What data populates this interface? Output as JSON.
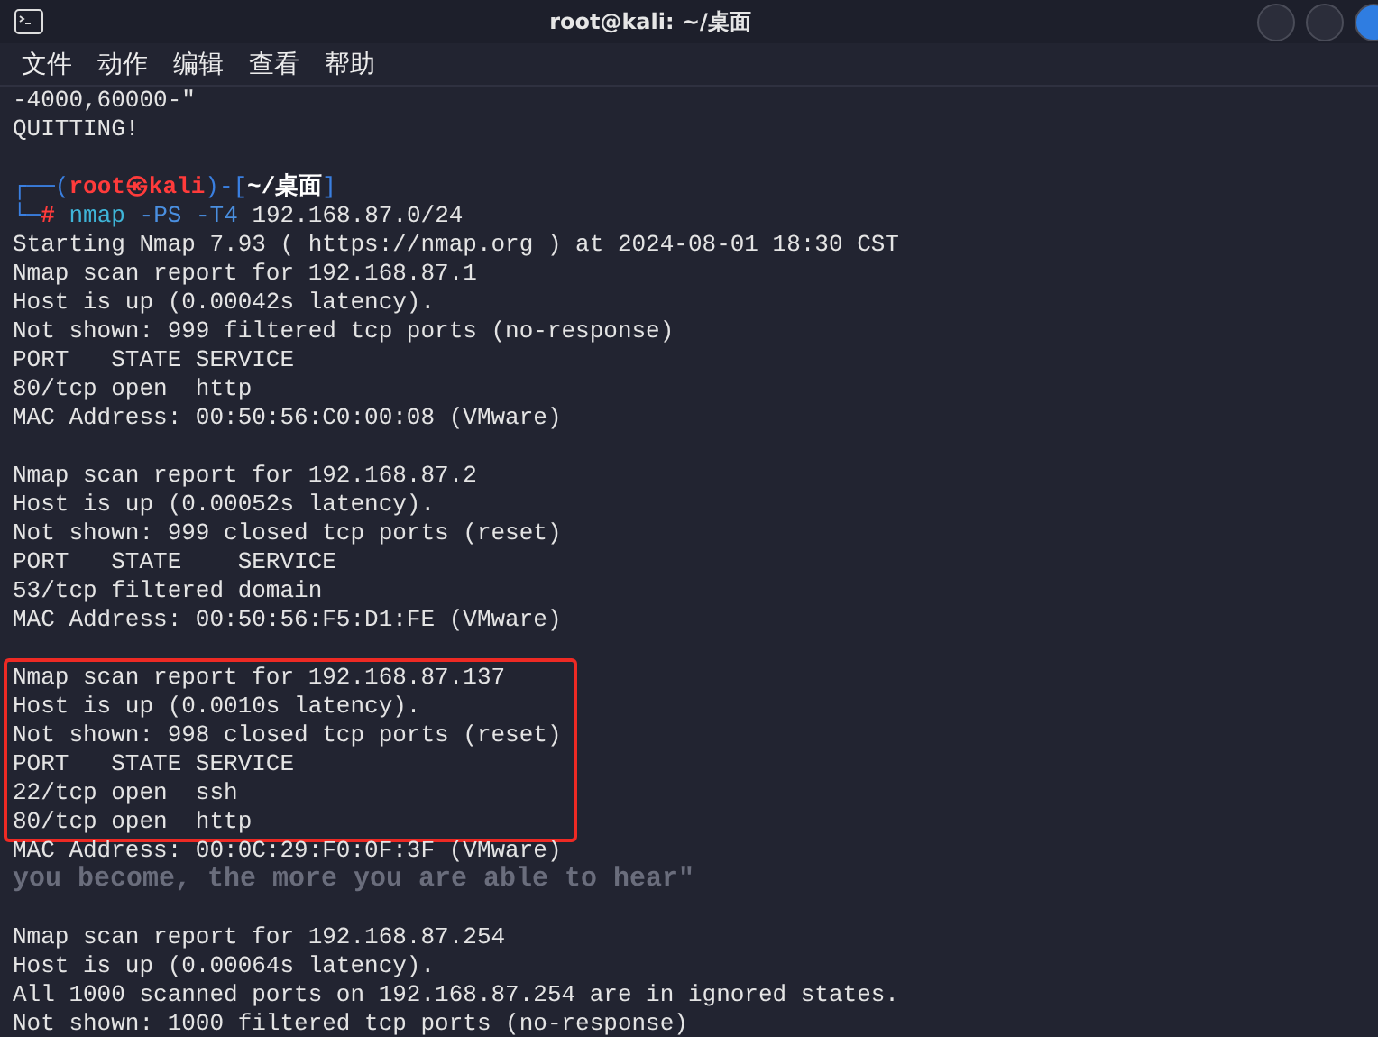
{
  "window": {
    "title": "root@kali: ~/桌面"
  },
  "menu": [
    "文件",
    "动作",
    "编辑",
    "查看",
    "帮助"
  ],
  "terminal": {
    "blocks": [
      {
        "highlighted": false,
        "lines": [
          {
            "kind": "text",
            "text": "-4000,60000-\""
          },
          {
            "kind": "text",
            "text": "QUITTING!"
          },
          {
            "kind": "blank"
          },
          {
            "kind": "prompt",
            "frame_open": "┌──(",
            "user": "root㉿kali",
            "frame_mid": ")-[",
            "path": "~/桌面",
            "frame_close": "]"
          },
          {
            "kind": "command",
            "frame": "└─",
            "sigil": "#",
            "program": "nmap",
            "options": "-PS -T4",
            "target": "192.168.87.0/24"
          },
          {
            "kind": "text",
            "text": "Starting Nmap 7.93 ( https://nmap.org ) at 2024-08-01 18:30 CST"
          },
          {
            "kind": "text",
            "text": "Nmap scan report for 192.168.87.1"
          },
          {
            "kind": "text",
            "text": "Host is up (0.00042s latency)."
          },
          {
            "kind": "text",
            "text": "Not shown: 999 filtered tcp ports (no-response)"
          },
          {
            "kind": "text",
            "text": "PORT   STATE SERVICE"
          },
          {
            "kind": "text",
            "text": "80/tcp open  http"
          },
          {
            "kind": "text",
            "text": "MAC Address: 00:50:56:C0:00:08 (VMware)"
          },
          {
            "kind": "blank"
          },
          {
            "kind": "text",
            "text": "Nmap scan report for 192.168.87.2"
          },
          {
            "kind": "text",
            "text": "Host is up (0.00052s latency)."
          },
          {
            "kind": "text",
            "text": "Not shown: 999 closed tcp ports (reset)"
          },
          {
            "kind": "text",
            "text": "PORT   STATE    SERVICE"
          },
          {
            "kind": "text",
            "text": "53/tcp filtered domain"
          },
          {
            "kind": "text",
            "text": "MAC Address: 00:50:56:F5:D1:FE (VMware)"
          },
          {
            "kind": "blank"
          }
        ]
      },
      {
        "highlighted": true,
        "lines": [
          {
            "kind": "text",
            "text": "Nmap scan report for 192.168.87.137"
          },
          {
            "kind": "text",
            "text": "Host is up (0.0010s latency)."
          },
          {
            "kind": "text",
            "text": "Not shown: 998 closed tcp ports (reset)"
          },
          {
            "kind": "text",
            "text": "PORT   STATE SERVICE"
          },
          {
            "kind": "text",
            "text": "22/tcp open  ssh"
          },
          {
            "kind": "text",
            "text": "80/tcp open  http"
          }
        ]
      },
      {
        "highlighted": false,
        "lines": [
          {
            "kind": "text",
            "text": "MAC Address: 00:0C:29:F0:0F:3F (VMware)"
          },
          {
            "kind": "wallpaper",
            "text": "you become, the more you are able to hear\""
          },
          {
            "kind": "blank"
          },
          {
            "kind": "text",
            "text": "Nmap scan report for 192.168.87.254"
          },
          {
            "kind": "text",
            "text": "Host is up (0.00064s latency)."
          },
          {
            "kind": "text",
            "text": "All 1000 scanned ports on 192.168.87.254 are in ignored states."
          },
          {
            "kind": "text",
            "text": "Not shown: 1000 filtered tcp ports (no-response)"
          }
        ]
      }
    ]
  }
}
